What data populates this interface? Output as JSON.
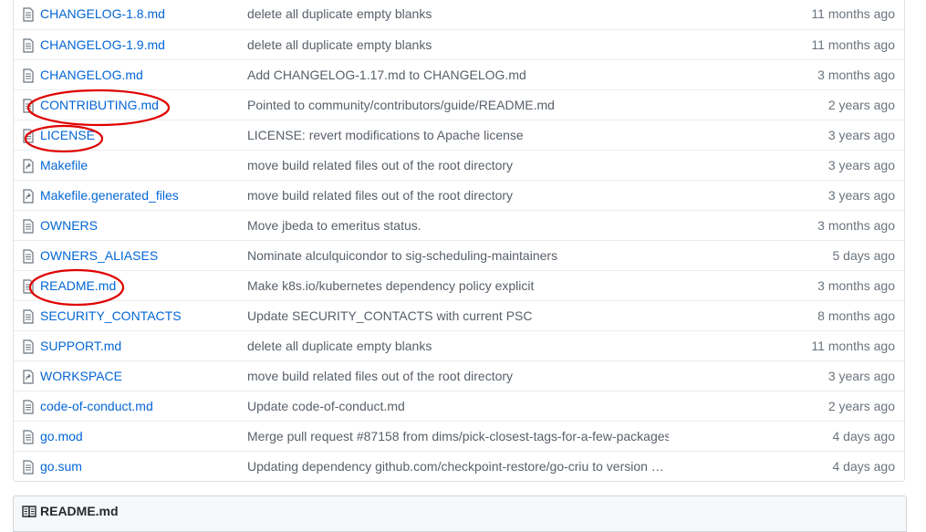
{
  "files": [
    {
      "name": "CHANGELOG-1.8.md",
      "message": "delete all duplicate empty blanks",
      "age": "11 months ago",
      "icon": "file-text-icon"
    },
    {
      "name": "CHANGELOG-1.9.md",
      "message": "delete all duplicate empty blanks",
      "age": "11 months ago",
      "icon": "file-text-icon"
    },
    {
      "name": "CHANGELOG.md",
      "message": "Add CHANGELOG-1.17.md to CHANGELOG.md",
      "age": "3 months ago",
      "icon": "file-text-icon"
    },
    {
      "name": "CONTRIBUTING.md",
      "message": "Pointed to community/contributors/guide/README.md",
      "age": "2 years ago",
      "icon": "file-text-icon"
    },
    {
      "name": "LICENSE",
      "message": "LICENSE: revert modifications to Apache license",
      "age": "3 years ago",
      "icon": "file-text-icon"
    },
    {
      "name": "Makefile",
      "message": "move build related files out of the root directory",
      "age": "3 years ago",
      "icon": "symlink-icon"
    },
    {
      "name": "Makefile.generated_files",
      "message": "move build related files out of the root directory",
      "age": "3 years ago",
      "icon": "symlink-icon"
    },
    {
      "name": "OWNERS",
      "message": "Move jbeda to emeritus status.",
      "age": "3 months ago",
      "icon": "file-text-icon"
    },
    {
      "name": "OWNERS_ALIASES",
      "message": "Nominate alculquicondor to sig-scheduling-maintainers",
      "age": "5 days ago",
      "icon": "file-text-icon"
    },
    {
      "name": "README.md",
      "message": "Make k8s.io/kubernetes dependency policy explicit",
      "age": "3 months ago",
      "icon": "file-text-icon"
    },
    {
      "name": "SECURITY_CONTACTS",
      "message": "Update SECURITY_CONTACTS with current PSC",
      "age": "8 months ago",
      "icon": "file-text-icon"
    },
    {
      "name": "SUPPORT.md",
      "message": "delete all duplicate empty blanks",
      "age": "11 months ago",
      "icon": "file-text-icon"
    },
    {
      "name": "WORKSPACE",
      "message": "move build related files out of the root directory",
      "age": "3 years ago",
      "icon": "symlink-icon"
    },
    {
      "name": "code-of-conduct.md",
      "message": "Update code-of-conduct.md",
      "age": "2 years ago",
      "icon": "file-text-icon"
    },
    {
      "name": "go.mod",
      "message": "Merge pull request #87158 from dims/pick-closest-tags-for-a-few-packages",
      "age": "4 days ago",
      "icon": "file-text-icon"
    },
    {
      "name": "go.sum",
      "message": "Updating dependency github.com/checkpoint-restore/go-criu to version …",
      "age": "4 days ago",
      "icon": "file-text-icon"
    }
  ],
  "readme": {
    "title": "README.md",
    "icon": "book-icon"
  },
  "highlighted_files": [
    "CONTRIBUTING.md",
    "LICENSE",
    "README.md"
  ],
  "colors": {
    "link": "#0366d6",
    "annotation": "#e00000",
    "border": "#eaecef"
  }
}
